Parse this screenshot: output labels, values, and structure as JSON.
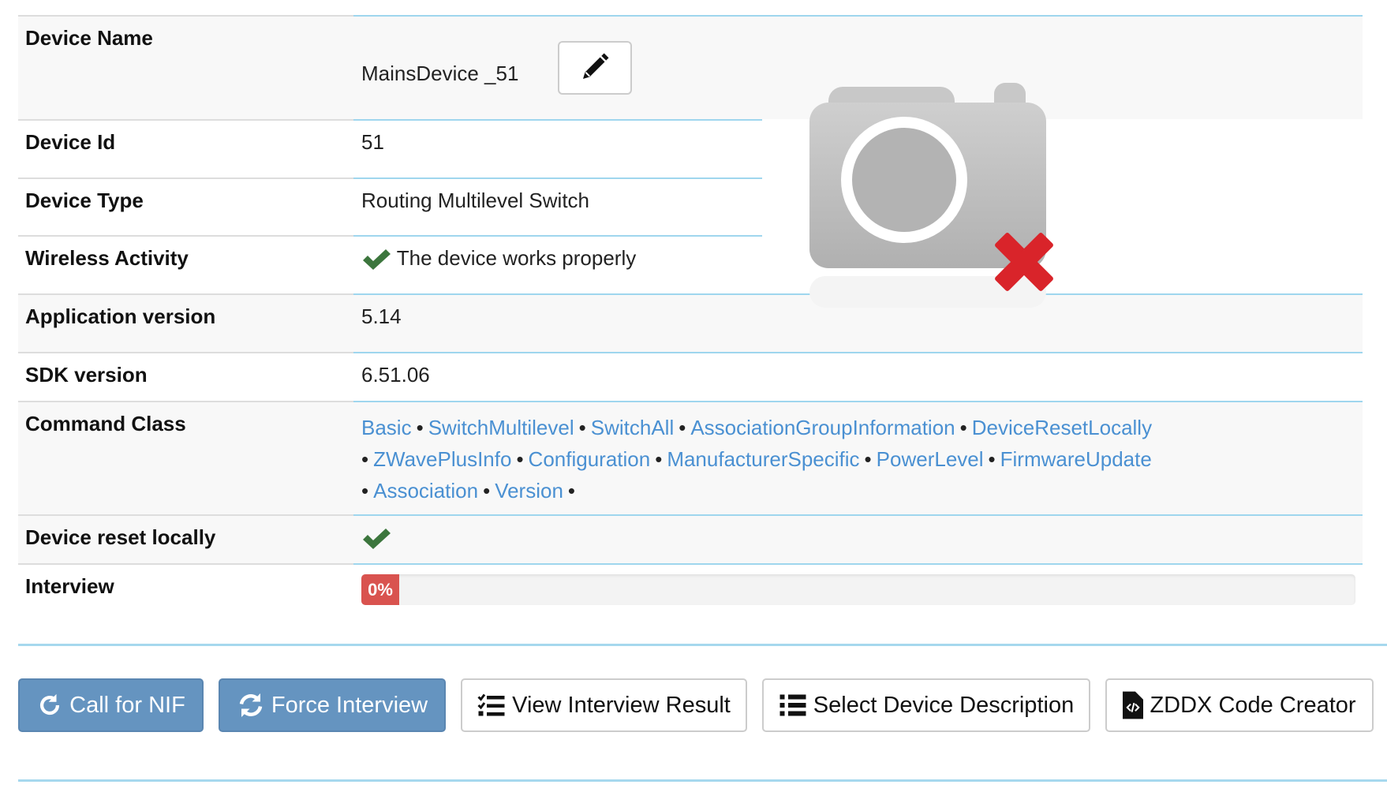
{
  "device": {
    "name_label": "Device Name",
    "name_value": "MainsDevice _51",
    "id_label": "Device Id",
    "id_value": "51",
    "type_label": "Device Type",
    "type_value": "Routing Multilevel Switch",
    "wireless_label": "Wireless Activity",
    "wireless_value": "The device works properly",
    "app_version_label": "Application version",
    "app_version_value": "5.14",
    "sdk_label": "SDK version",
    "sdk_value": "6.51.06",
    "command_class_label": "Command Class",
    "command_classes": [
      "Basic",
      "SwitchMultilevel",
      "SwitchAll",
      "AssociationGroupInformation",
      "DeviceResetLocally",
      "ZWavePlusInfo",
      "Configuration",
      "ManufacturerSpecific",
      "PowerLevel",
      "FirmwareUpdate",
      "Association",
      "Version"
    ],
    "separator": "•",
    "reset_label": "Device reset locally",
    "interview_label": "Interview",
    "interview_progress_text": "0%",
    "interview_progress": 0
  },
  "image": {
    "icon": "camera-missing-icon"
  },
  "buttons": {
    "call_nif": "Call for NIF",
    "force_interview": "Force Interview",
    "view_result": "View Interview Result",
    "select_description": "Select Device Description",
    "zddx": "ZDDX Code Creator"
  },
  "colors": {
    "link": "#4a90d2",
    "primary": "#6594c0",
    "danger": "#d9534f",
    "success": "#3c763d"
  }
}
